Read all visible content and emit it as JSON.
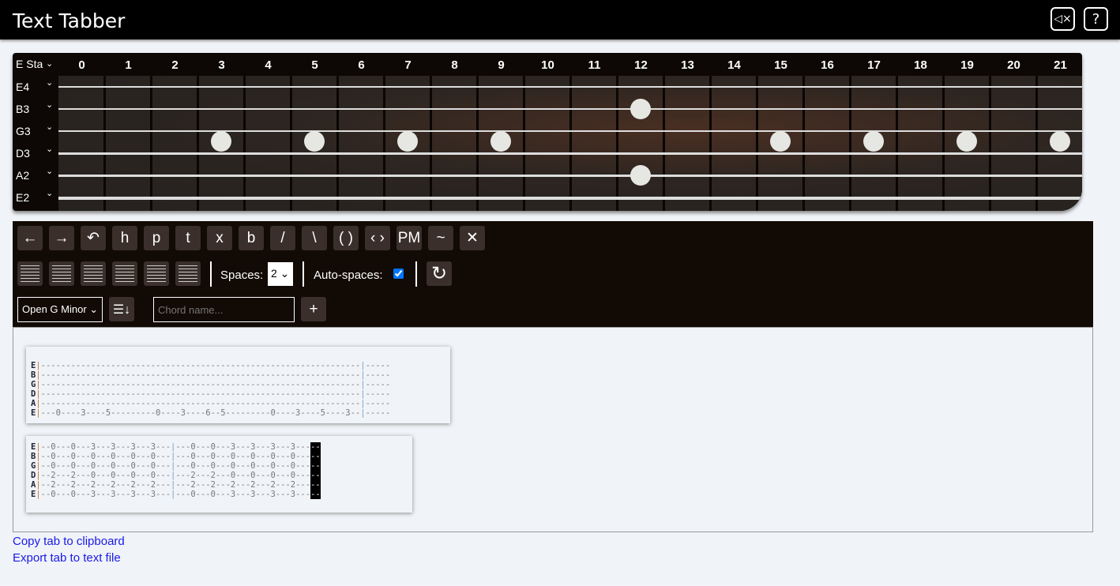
{
  "app": {
    "title": "Text Tabber",
    "mute_icon": "speaker-mute-icon",
    "help_label": "?"
  },
  "fretboard": {
    "tuning_label": "E Sta",
    "frets": [
      "0",
      "1",
      "2",
      "3",
      "4",
      "5",
      "6",
      "7",
      "8",
      "9",
      "10",
      "11",
      "12",
      "13",
      "14",
      "15",
      "16",
      "17",
      "18",
      "19",
      "20",
      "21"
    ],
    "strings": [
      "E4",
      "B3",
      "G3",
      "D3",
      "A2",
      "E2"
    ],
    "single_markers": [
      3,
      5,
      7,
      9,
      15,
      17,
      19,
      21
    ],
    "double_markers": [
      12
    ]
  },
  "toolbar": {
    "row1": [
      "←",
      "→",
      "↶",
      "h",
      "p",
      "t",
      "x",
      "b",
      "/",
      "\\",
      "( )",
      "‹ ›",
      "PM",
      "~",
      "✕"
    ],
    "row1_names": [
      "move-left-button",
      "move-right-button",
      "undo-button",
      "hammer-on-button",
      "pull-off-button",
      "tap-button",
      "mute-button",
      "bend-button",
      "slide-up-button",
      "slide-down-button",
      "ghost-note-button",
      "harmonic-button",
      "palm-mute-button",
      "vibrato-button",
      "clear-button"
    ],
    "spaces_label": "Spaces:",
    "spaces_value": "2",
    "autospaces_label": "Auto-spaces:",
    "autospaces_checked": true,
    "chord_select": "Open G Minor",
    "chord_placeholder": "Chord name...",
    "add_label": "+"
  },
  "tabs": [
    {
      "strings": [
        "E",
        "B",
        "G",
        "D",
        "A",
        "E"
      ],
      "lines": [
        "----------------------------------------------------------------",
        "----------------------------------------------------------------",
        "----------------------------------------------------------------",
        "----------------------------------------------------------------",
        "----------------------------------------------------------------",
        "---0----3----5---------0----3----6--5---------0----3----5----3--"
      ],
      "tail": "-----"
    },
    {
      "strings": [
        "E",
        "B",
        "G",
        "D",
        "A",
        "E"
      ],
      "m1": [
        "--0---0---3---3---3---3---",
        "--0---0---0---0---0---0---",
        "--0---0---0---0---0---0---",
        "--2---2---0---0---0---0---",
        "--2---2---2---2---2---2---",
        "--0---0---3---3---3---3---"
      ],
      "m2": [
        "---0---0---3---3---3---3---",
        "---0---0---0---0---0---0---",
        "---0---0---0---0---0---0---",
        "---2---2---0---0---0---0---",
        "---2---2---2---2---2---2---",
        "---0---0---3---3---3---3---"
      ],
      "cursor": "--"
    }
  ],
  "links": {
    "copy": "Copy tab to clipboard",
    "export": "Export tab to text file"
  }
}
